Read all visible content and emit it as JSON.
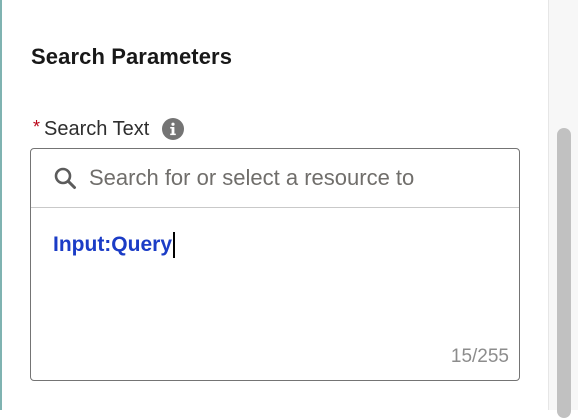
{
  "section": {
    "title": "Search Parameters"
  },
  "field": {
    "required_mark": "*",
    "label": "Search Text",
    "info_icon": "info-icon",
    "search_icon": "search-icon",
    "search_placeholder": "Search for or select a resource to",
    "value": "Input:Query",
    "char_count": "15/255"
  },
  "colors": {
    "required": "#ba0517",
    "value_text": "#1b3cc6",
    "border": "#747474"
  }
}
